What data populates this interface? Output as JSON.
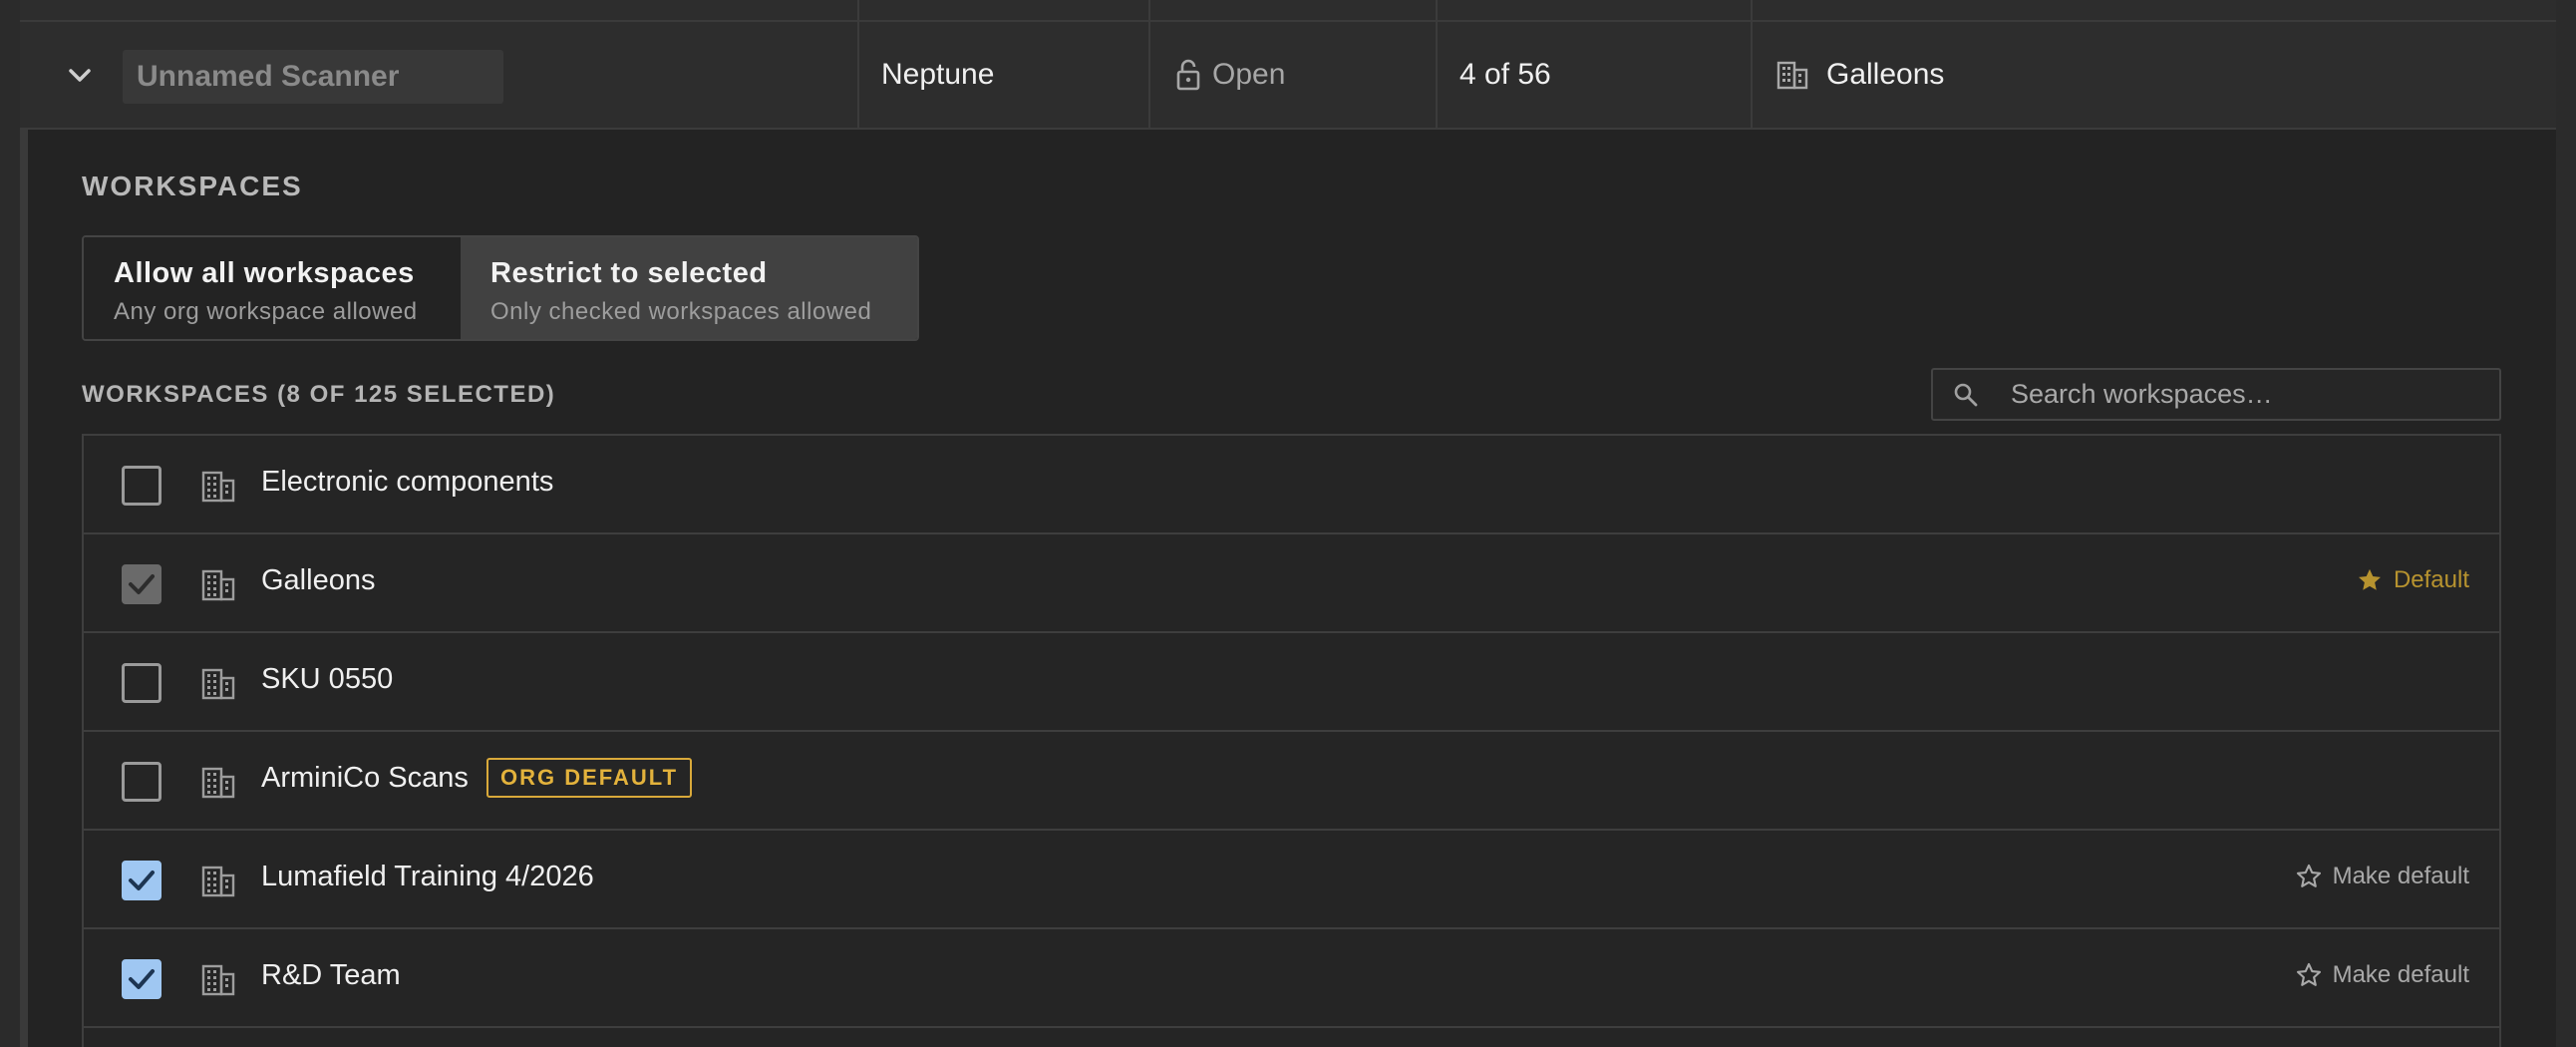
{
  "scanner": {
    "name_placeholder": "Unnamed Scanner",
    "location": "Neptune",
    "status": "Open",
    "count": "4 of 56",
    "workspace": "Galleons"
  },
  "panel": {
    "section_title": "WORKSPACES",
    "mode": {
      "allow_title": "Allow all workspaces",
      "allow_sub": "Any org workspace allowed",
      "restrict_title": "Restrict to selected",
      "restrict_sub": "Only checked workspaces allowed",
      "selected": "restrict"
    },
    "list_caption": "WORKSPACES (8 OF 125 SELECTED)",
    "search_placeholder": "Search workspaces…",
    "workspaces": [
      {
        "name": "Electronic components",
        "checked": false,
        "locked": false,
        "badge": "",
        "action": ""
      },
      {
        "name": "Galleons",
        "checked": true,
        "locked": true,
        "badge": "",
        "action": "Default"
      },
      {
        "name": "SKU 0550",
        "checked": false,
        "locked": false,
        "badge": "",
        "action": ""
      },
      {
        "name": "ArminiCo Scans",
        "checked": false,
        "locked": false,
        "badge": "ORG DEFAULT",
        "action": ""
      },
      {
        "name": "Lumafield Training 4/2026",
        "checked": true,
        "locked": false,
        "badge": "",
        "action": "Make default"
      },
      {
        "name": "R&D Team",
        "checked": true,
        "locked": false,
        "badge": "",
        "action": "Make default"
      }
    ]
  },
  "colors": {
    "accent_blue": "#9fc7f2",
    "gold": "#e3b23c",
    "default_gold": "#b7932f",
    "panel_bg": "#232323",
    "row_bg": "#2d2d2d"
  }
}
